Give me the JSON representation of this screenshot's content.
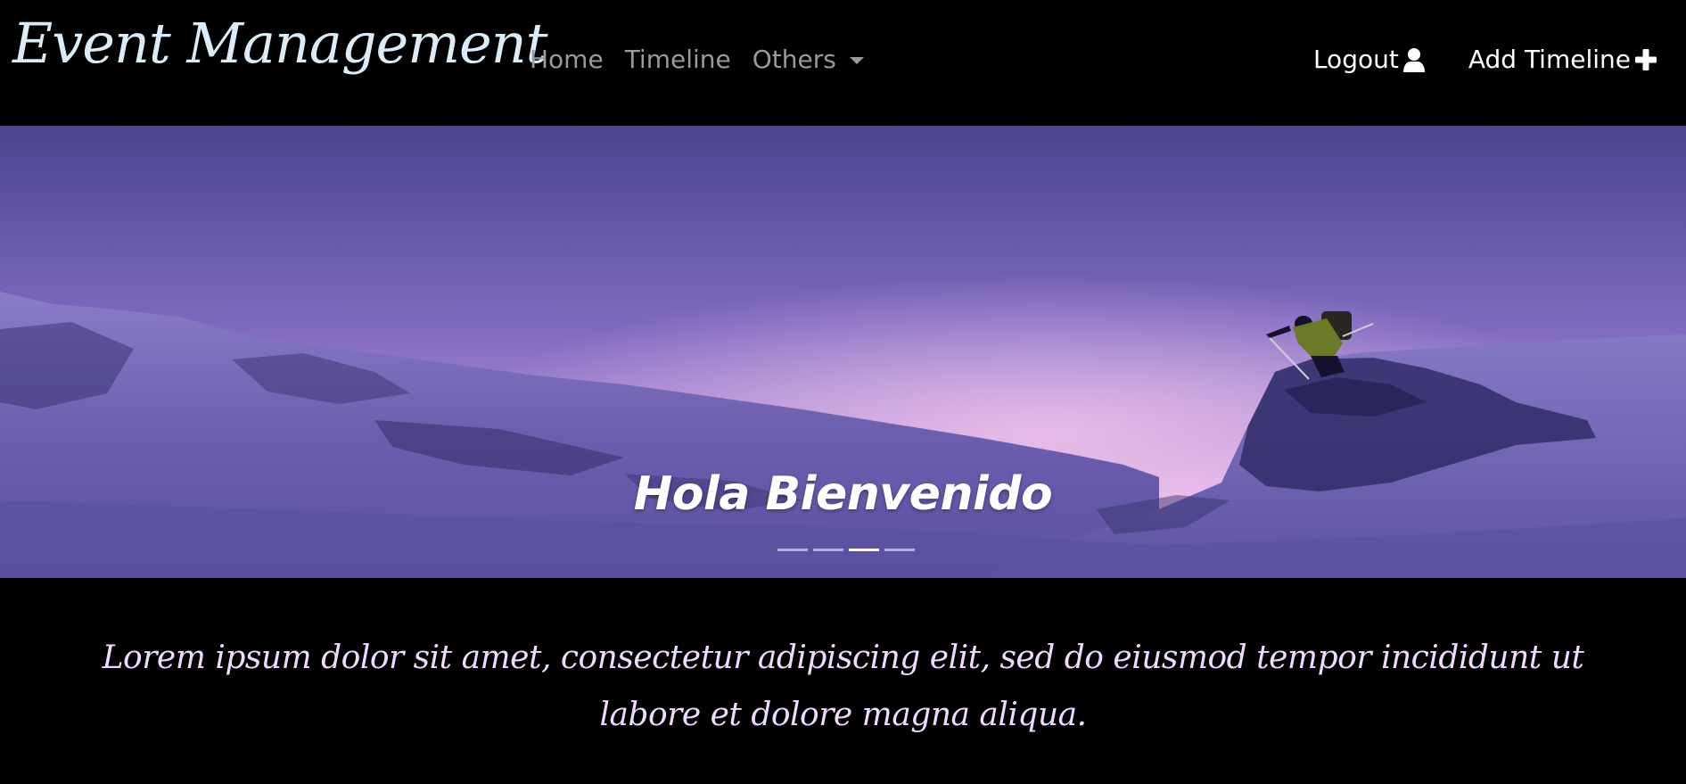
{
  "brand": {
    "title": "Event Management"
  },
  "nav": {
    "links": [
      {
        "label": "Home"
      },
      {
        "label": "Timeline"
      },
      {
        "label": "Others"
      }
    ],
    "actions": {
      "logout_label": "Logout",
      "add_timeline_label": "Add Timeline"
    }
  },
  "icons": {
    "logout": "user-icon",
    "add_timeline": "plus-icon",
    "dropdown": "caret-down-icon"
  },
  "hero": {
    "caption": "Hola Bienvenido",
    "slides_total": 4,
    "active_slide": 3
  },
  "intro": {
    "text": "Lorem ipsum dolor sit amet, consectetur adipiscing elit, sed do eiusmod tempor incididunt ut labore et dolore magna aliqua."
  },
  "colors": {
    "background": "#000000",
    "brand": "#dcecf7",
    "nav_muted": "#9a9a9a",
    "nav_active": "#ffffff",
    "intro_text": "#efdaff",
    "sky_top": "#4b4690",
    "sky_horizon": "#c9a0dc",
    "snow": "#6e62b0"
  }
}
